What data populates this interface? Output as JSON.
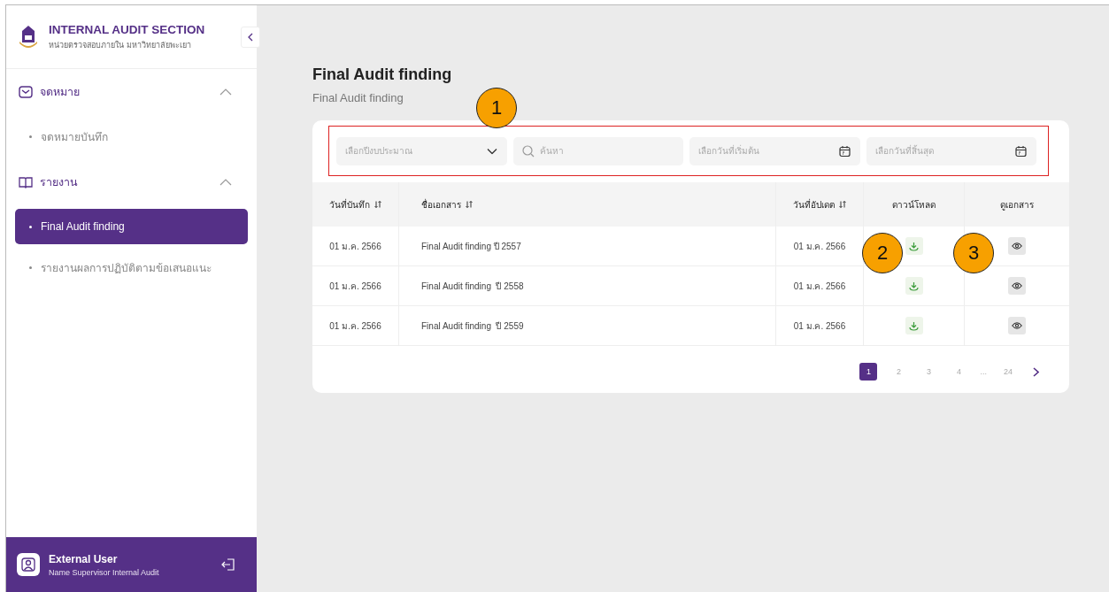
{
  "sidebar": {
    "org_title": "INTERNAL AUDIT SECTION",
    "org_subtitle": "หน่วยตรวจสอบภายใน มหาวิทยาลัยพะเยา",
    "sections": [
      {
        "label": "จดหมาย",
        "expanded": true,
        "items": [
          {
            "label": "จดหมายบันทึก",
            "selected": false
          }
        ]
      },
      {
        "label": "รายงาน",
        "expanded": true,
        "items": [
          {
            "label": "Final Audit finding",
            "selected": true
          },
          {
            "label": "รายงานผลการปฏิบัติตามข้อเสนอแนะ",
            "selected": false
          }
        ]
      }
    ],
    "user": {
      "name": "External User",
      "role": "Name Supervisor Internal Audit"
    }
  },
  "page": {
    "title": "Final Audit finding",
    "subtitle": "Final Audit finding"
  },
  "filters": {
    "highlighted": true,
    "budget_year": {
      "placeholder": "เลือกปีงบประมาณ"
    },
    "search": {
      "placeholder": "ค้นหา"
    },
    "start_date": {
      "placeholder": "เลือกวันที่เริ่มต้น"
    },
    "end_date": {
      "placeholder": "เลือกวันที่สิ้นสุด"
    }
  },
  "table": {
    "columns": [
      {
        "label": "วันที่บันทึก",
        "sortable": true
      },
      {
        "label": "ชื่อเอกสาร",
        "sortable": true
      },
      {
        "label": "วันที่อัปเดต",
        "sortable": true
      },
      {
        "label": "ดาวน์โหลด",
        "sortable": false
      },
      {
        "label": "ดูเอกสาร",
        "sortable": false
      }
    ],
    "rows": [
      {
        "recorded": "01 ม.ค. 2566",
        "name": "Final Audit finding ปี 2557",
        "updated": "01 ม.ค. 2566"
      },
      {
        "recorded": "01 ม.ค. 2566",
        "name": "Final Audit finding  ปี 2558",
        "updated": "01 ม.ค. 2566"
      },
      {
        "recorded": "01 ม.ค. 2566",
        "name": "Final Audit finding  ปี 2559",
        "updated": "01 ม.ค. 2566"
      }
    ]
  },
  "pagination": [
    {
      "kind": "page",
      "label": "1",
      "selected": true
    },
    {
      "kind": "page",
      "label": "2",
      "selected": false
    },
    {
      "kind": "page",
      "label": "3",
      "selected": false
    },
    {
      "kind": "page",
      "label": "4",
      "selected": false
    },
    {
      "kind": "ellipsis",
      "label": "..."
    },
    {
      "kind": "page",
      "label": "24",
      "selected": false
    }
  ],
  "annotations": [
    {
      "label": "1"
    },
    {
      "label": "2"
    },
    {
      "label": "3"
    }
  ]
}
